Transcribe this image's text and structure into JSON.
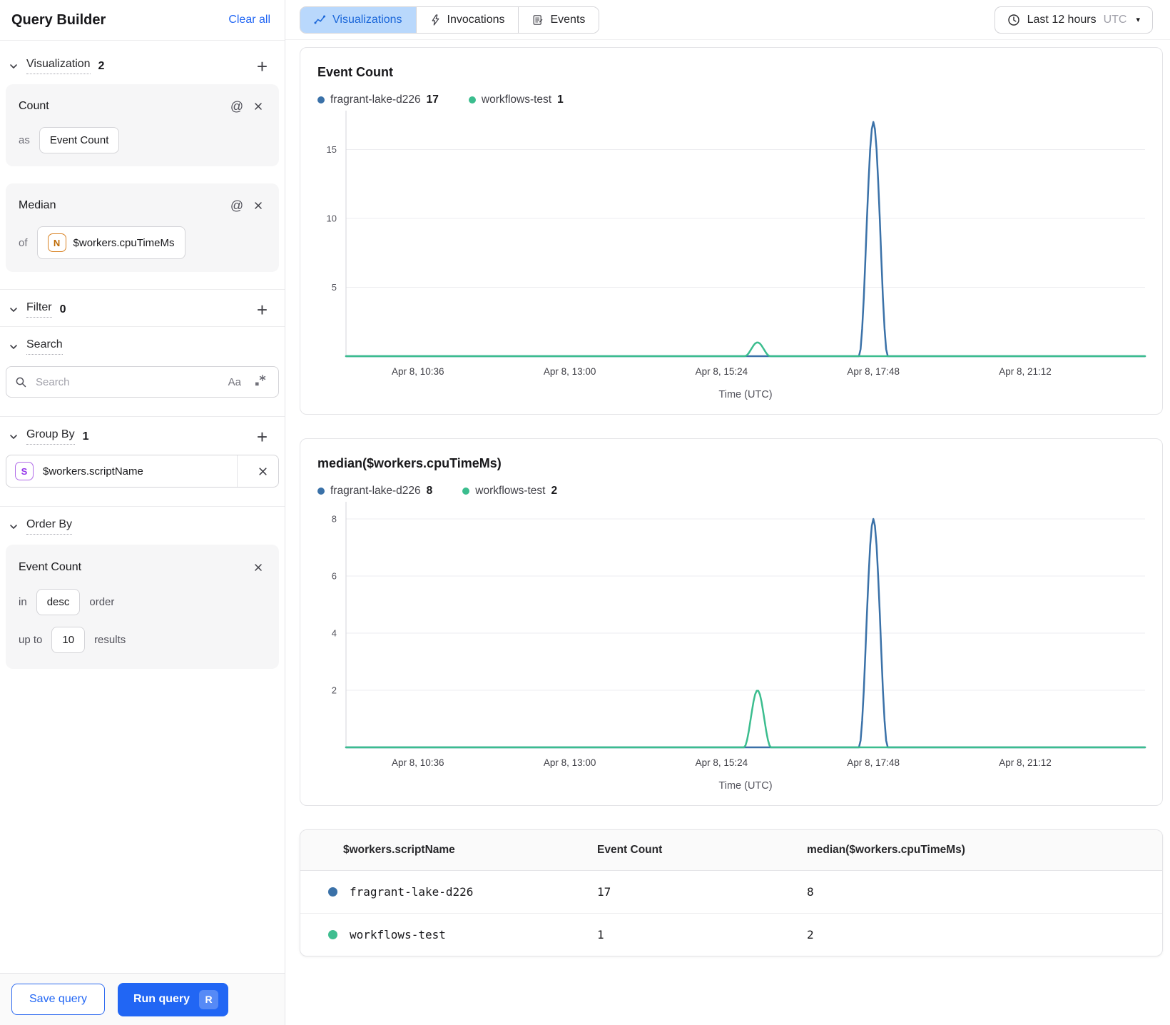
{
  "sidebar": {
    "title": "Query Builder",
    "clear_all": "Clear all",
    "visualization": {
      "label": "Visualization",
      "count": "2"
    },
    "count_card": {
      "title": "Count",
      "prefix": "as",
      "value": "Event Count"
    },
    "median_card": {
      "title": "Median",
      "prefix": "of",
      "type_badge": "N",
      "value": "$workers.cpuTimeMs"
    },
    "filter": {
      "label": "Filter",
      "count": "0"
    },
    "search": {
      "label": "Search",
      "placeholder": "Search",
      "case_toggle": "Aa"
    },
    "group_by": {
      "label": "Group By",
      "count": "1",
      "item": {
        "type_badge": "S",
        "value": "$workers.scriptName"
      }
    },
    "order_by": {
      "label": "Order By",
      "field": "Event Count",
      "in_label": "in",
      "direction": "desc",
      "order_label": "order",
      "up_to_label": "up to",
      "limit": "10",
      "results_label": "results"
    },
    "footer": {
      "save": "Save query",
      "run": "Run query",
      "shortcut": "R"
    }
  },
  "tabs": {
    "visualizations": "Visualizations",
    "invocations": "Invocations",
    "events": "Events"
  },
  "time_picker": {
    "range": "Last 12 hours",
    "zone": "UTC"
  },
  "icons": {
    "at": "@",
    "caret": "▾",
    "plus": "+"
  },
  "colors": {
    "accent_blue": "#2166f4",
    "active_tab_bg": "#b9d8fc",
    "series_blue": "#3A71A8",
    "series_green": "#3BBD8E"
  },
  "chart_data": [
    {
      "type": "line",
      "title": "Event Count",
      "legend": [
        {
          "name": "fragrant-lake-d226",
          "value": "17",
          "color": "#3A71A8"
        },
        {
          "name": "workflows-test",
          "value": "1",
          "color": "#3BBD8E"
        }
      ],
      "xlabel": "Time (UTC)",
      "ylim": [
        0,
        17.2
      ],
      "yticks": [
        5,
        10,
        15
      ],
      "grid": true,
      "legend_position": "top",
      "xticks": [
        "Apr 8, 10:36",
        "Apr 8, 13:00",
        "Apr 8, 15:24",
        "Apr 8, 17:48",
        "Apr 8, 21:12"
      ],
      "xtick_fractions": [
        0.09,
        0.28,
        0.47,
        0.66,
        0.85
      ],
      "series": [
        {
          "name": "fragrant-lake-d226",
          "color": "#3A71A8",
          "baseline": 0,
          "peaks": [
            {
              "center": 0.66,
              "halfwidth": 0.018,
              "height": 17
            }
          ]
        },
        {
          "name": "workflows-test",
          "color": "#3BBD8E",
          "baseline": 0,
          "peaks": [
            {
              "center": 0.515,
              "halfwidth": 0.016,
              "height": 1
            }
          ]
        }
      ]
    },
    {
      "type": "line",
      "title": "median($workers.cpuTimeMs)",
      "legend": [
        {
          "name": "fragrant-lake-d226",
          "value": "8",
          "color": "#3A71A8"
        },
        {
          "name": "workflows-test",
          "value": "2",
          "color": "#3BBD8E"
        }
      ],
      "xlabel": "Time (UTC)",
      "ylim": [
        0,
        8.3
      ],
      "yticks": [
        2,
        4,
        6,
        8
      ],
      "grid": true,
      "legend_position": "top",
      "xticks": [
        "Apr 8, 10:36",
        "Apr 8, 13:00",
        "Apr 8, 15:24",
        "Apr 8, 17:48",
        "Apr 8, 21:12"
      ],
      "xtick_fractions": [
        0.09,
        0.28,
        0.47,
        0.66,
        0.85
      ],
      "series": [
        {
          "name": "fragrant-lake-d226",
          "color": "#3A71A8",
          "baseline": 0,
          "peaks": [
            {
              "center": 0.66,
              "halfwidth": 0.018,
              "height": 8
            }
          ]
        },
        {
          "name": "workflows-test",
          "color": "#3BBD8E",
          "baseline": 0,
          "peaks": [
            {
              "center": 0.515,
              "halfwidth": 0.017,
              "height": 2
            }
          ]
        }
      ]
    }
  ],
  "results_table": {
    "columns": [
      "$workers.scriptName",
      "Event Count",
      "median($workers.cpuTimeMs)"
    ],
    "rows": [
      {
        "color": "#3A71A8",
        "script_name": "fragrant-lake-d226",
        "event_count": "17",
        "median_cpu": "8"
      },
      {
        "color": "#3FBE90",
        "script_name": "workflows-test",
        "event_count": "1",
        "median_cpu": "2"
      }
    ]
  }
}
